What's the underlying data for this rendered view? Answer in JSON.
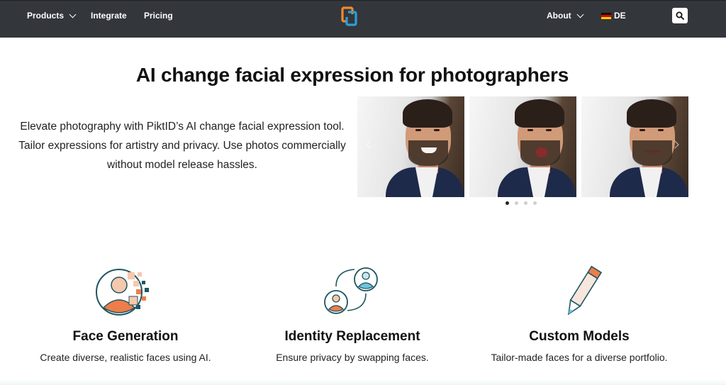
{
  "nav": {
    "products": "Products",
    "integrate": "Integrate",
    "pricing": "Pricing",
    "about": "About",
    "language": "DE",
    "logo_colors": [
      "#f28a2e",
      "#2aa0d8"
    ],
    "bg_color": "#33363b"
  },
  "hero": {
    "title": "AI change facial expression for photographers",
    "text": "Elevate photography with PiktID’s AI change facial expression tool. Tailor expressions for artistry and privacy. Use photos commercially without model release hassles.",
    "carousel": {
      "slides": [
        "smile",
        "surprised",
        "neutral"
      ],
      "dots": 4,
      "active_dot": 0
    }
  },
  "features": [
    {
      "title": "Face Generation",
      "desc": "Create diverse, realistic faces using AI.",
      "icon": "face-generation-icon"
    },
    {
      "title": "Identity Replacement",
      "desc": "Ensure privacy by swapping faces.",
      "icon": "identity-swap-icon"
    },
    {
      "title": "Custom Models",
      "desc": "Tailor-made faces for a diverse portfolio.",
      "icon": "pencil-icon"
    }
  ],
  "colors": {
    "accent_orange": "#ee7d4a",
    "accent_blue": "#6fc3dc",
    "outline": "#1d5660"
  }
}
